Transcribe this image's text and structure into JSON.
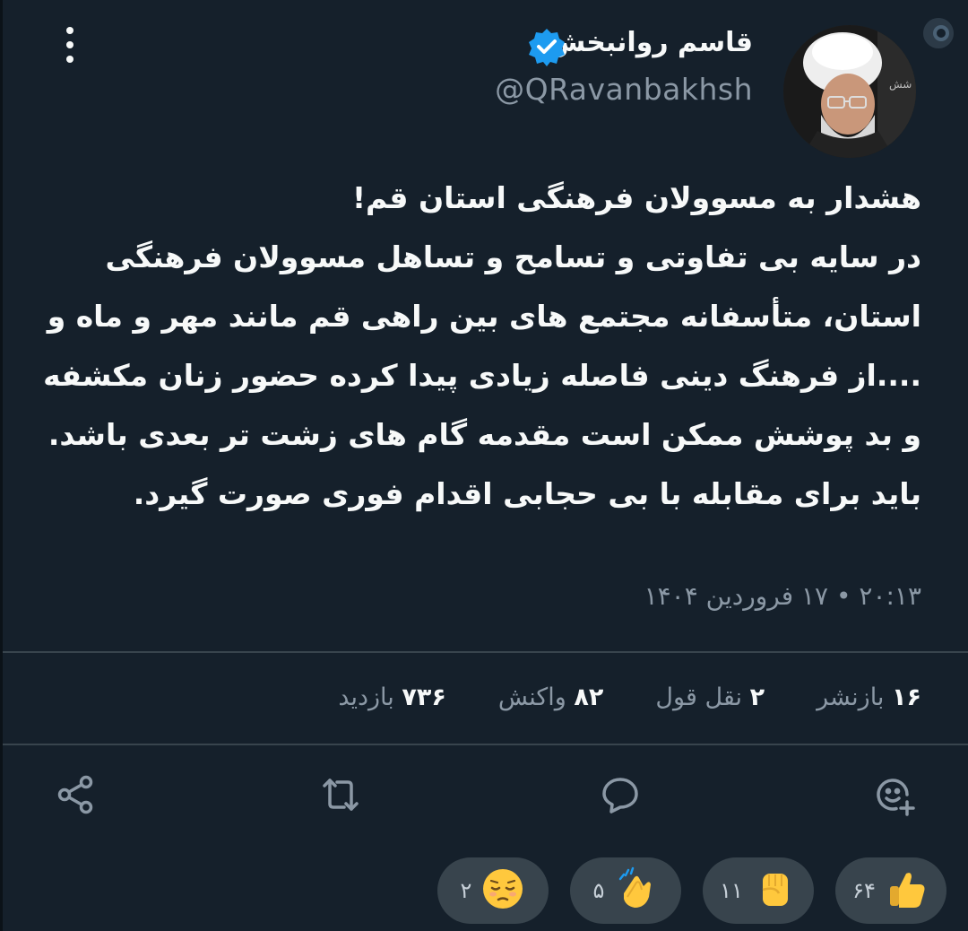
{
  "author": {
    "display_name": "قاسم روانبخش",
    "handle": "@QRavanbakhsh",
    "verified": true
  },
  "tweet": {
    "text": "هشدار به مسوولان فرهنگی استان قم!\nدر سایه بی تفاوتی و تسامح و تساهل مسوولان فرهنگی\nاستان، متأسفانه مجتمع های بین راهی قم مانند مهر و ماه و\n....از فرهنگ دینی فاصله زیادی پیدا کرده حضور زنان مکشفه\nو بد پوشش ممکن است مقدمه گام های زشت تر بعدی باشد.\nباید برای مقابله با بی حجابی اقدام فوری صورت گیرد.",
    "timestamp": "۲۰:۱۳ • ۱۷ فروردین ۱۴۰۴"
  },
  "stats": [
    {
      "number": "۱۶",
      "label": "بازنشر"
    },
    {
      "number": "۲",
      "label": "نقل قول"
    },
    {
      "number": "۸۲",
      "label": "واکنش"
    },
    {
      "number": "۷۳۶",
      "label": "بازدید"
    }
  ],
  "actions": {
    "react_icon": "add-reaction-icon",
    "reply_icon": "reply-icon",
    "retweet_icon": "retweet-icon",
    "share_icon": "share-icon"
  },
  "reactions": [
    {
      "emoji": "thumbs-up",
      "count": "۶۴"
    },
    {
      "emoji": "raised-fist",
      "count": "۱۱"
    },
    {
      "emoji": "clapping-hands",
      "count": "۵"
    },
    {
      "emoji": "pensive-face",
      "count": "۲"
    }
  ],
  "colors": {
    "background": "#15202b",
    "text": "#f7f9f9",
    "muted": "#8b98a5",
    "divider": "#38444d",
    "verified": "#1d9bf0",
    "emoji_yellow": "#ffc83d"
  }
}
